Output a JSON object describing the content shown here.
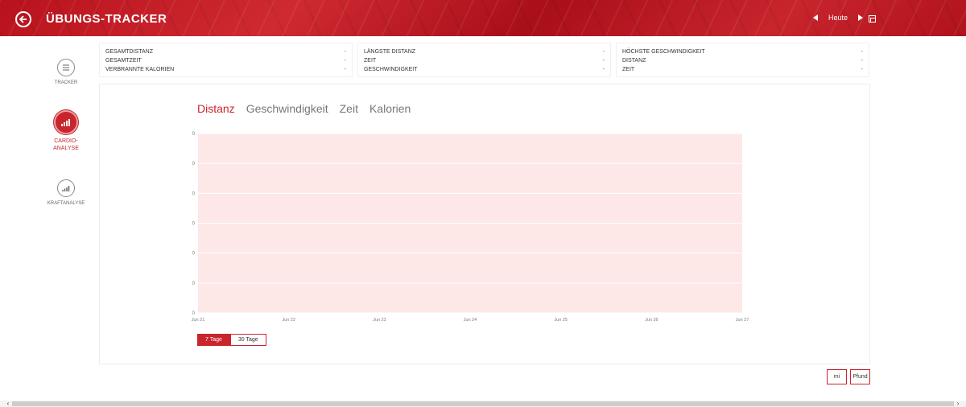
{
  "header": {
    "title": "ÜBUNGS-TRACKER",
    "today_label": "Heute"
  },
  "sidebar": {
    "items": [
      {
        "label": "TRACKER"
      },
      {
        "label": "CARDIO-ANALYSE"
      },
      {
        "label": "KRAFTANALYSE"
      }
    ]
  },
  "stats": {
    "card1": [
      {
        "label": "GESAMTDISTANZ",
        "value": "-"
      },
      {
        "label": "GESAMTZEIT",
        "value": "-"
      },
      {
        "label": "VERBRANNTE KALORIEN",
        "value": "-"
      }
    ],
    "card2": [
      {
        "label": "LÄNGSTE DISTANZ",
        "value": "-"
      },
      {
        "label": "ZEIT",
        "value": "-"
      },
      {
        "label": "GESCHWINDIGKEIT",
        "value": "-"
      }
    ],
    "card3": [
      {
        "label": "HÖCHSTE GESCHWINDIGKEIT",
        "value": "-"
      },
      {
        "label": "DISTANZ",
        "value": "-"
      },
      {
        "label": "ZEIT",
        "value": "-"
      }
    ]
  },
  "tabs": [
    "Distanz",
    "Geschwindigkeit",
    "Zeit",
    "Kalorien"
  ],
  "range": {
    "seven": "7 Tage",
    "thirty": "30 Tage"
  },
  "units": {
    "distance": "mi",
    "weight": "Pfund"
  },
  "colors": {
    "accent": "#c8252d",
    "plot_fill": "#fde8e7"
  },
  "chart_data": {
    "type": "area",
    "categories": [
      "Jun 21",
      "Jun 22",
      "Jun 23",
      "Jun 24",
      "Jun 25",
      "Jun 26",
      "Jun 27"
    ],
    "values": [
      0,
      0,
      0,
      0,
      0,
      0,
      0
    ],
    "y_ticks": [
      "0",
      "0",
      "0",
      "0",
      "0",
      "0",
      "0"
    ],
    "grid": true,
    "title": "",
    "xlabel": "",
    "ylabel": ""
  }
}
